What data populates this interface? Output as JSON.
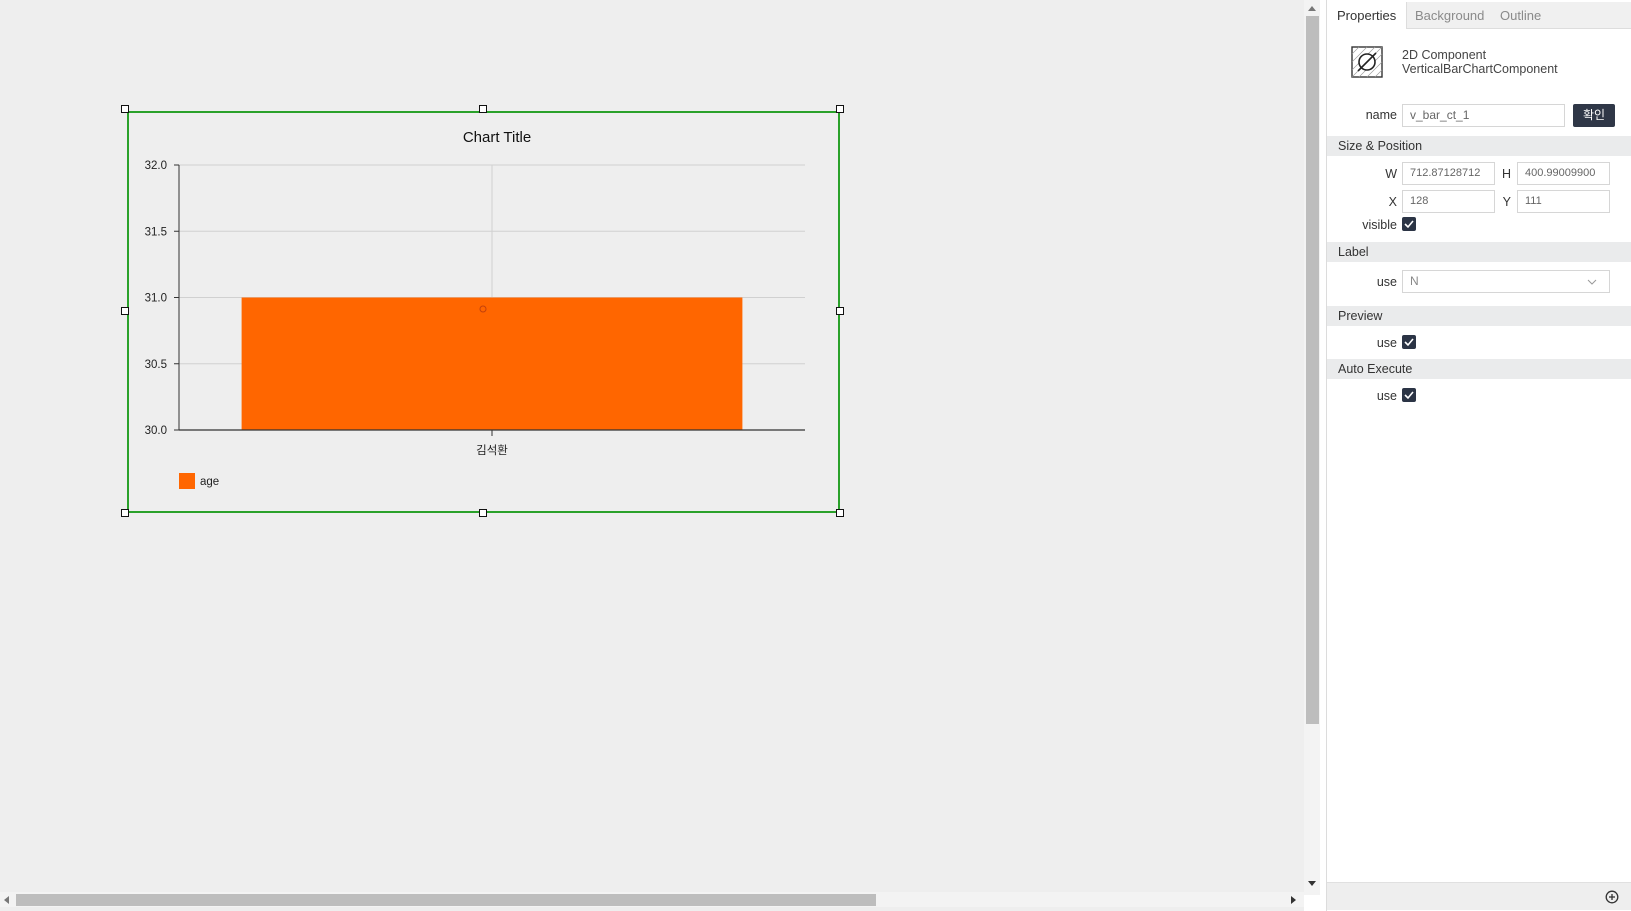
{
  "chart_data": {
    "type": "bar",
    "title": "Chart Title",
    "categories": [
      "김석환"
    ],
    "series": [
      {
        "name": "age",
        "values": [
          31.0
        ],
        "color": "#ff6600"
      }
    ],
    "ylim": [
      30.0,
      32.0
    ],
    "yticks": [
      "32.0",
      "31.5",
      "31.0",
      "30.5",
      "30.0"
    ],
    "grid": true,
    "legend": "bottom-left"
  },
  "panel": {
    "tabs": [
      {
        "label": "Properties"
      },
      {
        "label": "Background"
      },
      {
        "label": "Outline"
      }
    ],
    "component": {
      "kind": "2D Component",
      "type": "VerticalBarChartComponent",
      "icon": "component-icon"
    },
    "name": {
      "label": "name",
      "value": "v_bar_ct_1",
      "button": "확인"
    },
    "size_position": {
      "title": "Size & Position",
      "w_label": "W",
      "w_value": "712.87128712",
      "h_label": "H",
      "h_value": "400.99009900",
      "x_label": "X",
      "x_value": "128",
      "y_label": "Y",
      "y_value": "111",
      "visible_label": "visible",
      "visible": true
    },
    "label_section": {
      "title": "Label",
      "use_label": "use",
      "use_value": "N"
    },
    "preview": {
      "title": "Preview",
      "use_label": "use",
      "use": true
    },
    "auto_execute": {
      "title": "Auto Execute",
      "use_label": "use",
      "use": true
    },
    "footer_icon": "add-circle-icon"
  },
  "colors": {
    "selection": "#2aa12a",
    "bar": "#ff6600",
    "button": "#2f3747"
  }
}
